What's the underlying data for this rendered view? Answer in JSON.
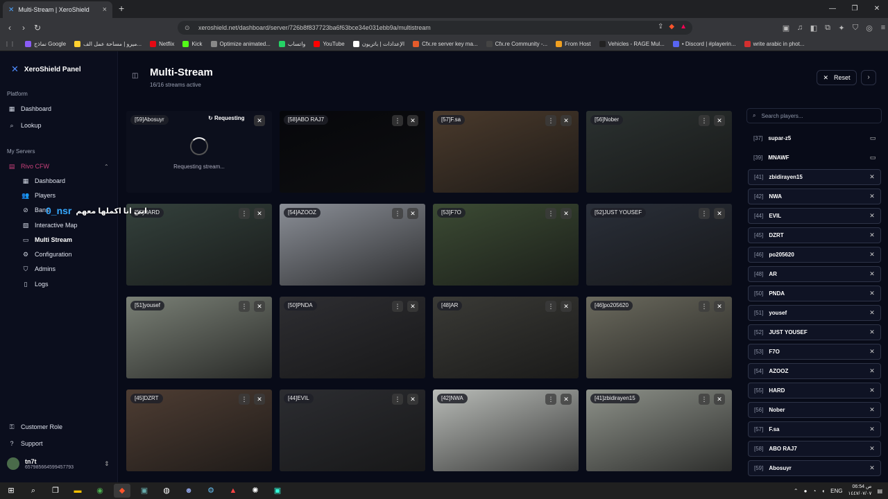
{
  "browser": {
    "tab_title": "Multi-Stream | XeroShield",
    "url": "xeroshield.net/dashboard/server/726b8f837723ba6f63bce34e031ebb9a/multistream",
    "bookmarks": [
      {
        "label": "نماذج Google",
        "color": "#8a5cf6"
      },
      {
        "label": "ميرو | مساحة عمل الف...",
        "color": "#ffd02f"
      },
      {
        "label": "Netflix",
        "color": "#e50914"
      },
      {
        "label": "Kick",
        "color": "#53fc18"
      },
      {
        "label": "Optimize animated...",
        "color": "#888888"
      },
      {
        "label": "واتساب",
        "color": "#25d366"
      },
      {
        "label": "YouTube",
        "color": "#ff0000"
      },
      {
        "label": "الإعدادات | باتريون",
        "color": "#ffffff"
      },
      {
        "label": "Cfx.re server key ma...",
        "color": "#e55b2b"
      },
      {
        "label": "Cfx.re Community -...",
        "color": "#444444"
      },
      {
        "label": "From Host",
        "color": "#f0a020"
      },
      {
        "label": "Vehicles - RAGE Mul...",
        "color": "#222222"
      },
      {
        "label": "• Discord | #playerin...",
        "color": "#5865f2"
      },
      {
        "label": "write arabic in phot...",
        "color": "#d32f2f"
      }
    ]
  },
  "sidebar": {
    "brand": "XeroShield Panel",
    "platform_label": "Platform",
    "platform_items": [
      {
        "label": "Dashboard",
        "icon": "grid-icon"
      },
      {
        "label": "Lookup",
        "icon": "search-icon"
      }
    ],
    "my_servers_label": "My Servers",
    "server_name": "Rivo CFW",
    "server_items": [
      {
        "label": "Dashboard"
      },
      {
        "label": "Players"
      },
      {
        "label": "Bans"
      },
      {
        "label": "Interactive Map"
      },
      {
        "label": "Multi Stream"
      },
      {
        "label": "Configuration"
      },
      {
        "label": "Admins"
      },
      {
        "label": "Logs"
      }
    ],
    "customer_role": "Customer Role",
    "support": "Support",
    "user_name": "tn7t",
    "user_id": "657985664599457793"
  },
  "header": {
    "title": "Multi-Stream",
    "subtitle": "16/16 streams active",
    "reset_label": "Reset"
  },
  "streams": [
    {
      "tag": "[59]Abosuyr",
      "status": "Requesting",
      "message": "Requesting stream...",
      "scene": "#0c0f1c"
    },
    {
      "tag": "[58]ABO RAJ7",
      "scene": "#06070b"
    },
    {
      "tag": "[57]F.sa",
      "scene": "#4a3a2c"
    },
    {
      "tag": "[56]Nober",
      "scene": "#2b3130"
    },
    {
      "tag": "[55]HARD",
      "scene": "#34413c"
    },
    {
      "tag": "[54]AZOOZ",
      "scene": "#8b8f97"
    },
    {
      "tag": "[53]F7O",
      "scene": "#3c4b34"
    },
    {
      "tag": "[52]JUST YOUSEF",
      "scene": "#2a2f39"
    },
    {
      "tag": "[51]yousef",
      "scene": "#7a8076"
    },
    {
      "tag": "[50]PNDA",
      "scene": "#2e2e32"
    },
    {
      "tag": "[48]AR",
      "scene": "#3a3a36"
    },
    {
      "tag": "[46]po205620",
      "scene": "#6b6a5e"
    },
    {
      "tag": "[45]DZRT",
      "scene": "#4e3d33"
    },
    {
      "tag": "[44]EVIL",
      "scene": "#2c2d31"
    },
    {
      "tag": "[42]NWA",
      "scene": "#b9bcb8"
    },
    {
      "tag": "[41]zbidirayen15",
      "scene": "#8e928a"
    }
  ],
  "search": {
    "placeholder": "Search players..."
  },
  "players": [
    {
      "id": "[37]",
      "name": "supar-z5",
      "selected": false
    },
    {
      "id": "[39]",
      "name": "MNAWF",
      "selected": false
    },
    {
      "id": "[41]",
      "name": "zbidirayen15",
      "selected": true
    },
    {
      "id": "[42]",
      "name": "NWA",
      "selected": true
    },
    {
      "id": "[44]",
      "name": "EVIL",
      "selected": true
    },
    {
      "id": "[45]",
      "name": "DZRT",
      "selected": true
    },
    {
      "id": "[46]",
      "name": "po205620",
      "selected": true
    },
    {
      "id": "[48]",
      "name": "AR",
      "selected": true
    },
    {
      "id": "[50]",
      "name": "PNDA",
      "selected": true
    },
    {
      "id": "[51]",
      "name": "yousef",
      "selected": true
    },
    {
      "id": "[52]",
      "name": "JUST YOUSEF",
      "selected": true
    },
    {
      "id": "[53]",
      "name": "F7O",
      "selected": true
    },
    {
      "id": "[54]",
      "name": "AZOOZ",
      "selected": true
    },
    {
      "id": "[55]",
      "name": "HARD",
      "selected": true
    },
    {
      "id": "[56]",
      "name": "Nober",
      "selected": true
    },
    {
      "id": "[57]",
      "name": "F.sa",
      "selected": true
    },
    {
      "id": "[58]",
      "name": "ABO RAJ7",
      "selected": true
    },
    {
      "id": "[59]",
      "name": "Abosuyr",
      "selected": true
    }
  ],
  "overlay": {
    "arabic": "ابي انا اكملها معهم",
    "nick": "0_nsr"
  },
  "taskbar": {
    "lang": "ENG",
    "time": "06:54 ص",
    "date": "١٤٤٧/٠٧/٠٧"
  }
}
